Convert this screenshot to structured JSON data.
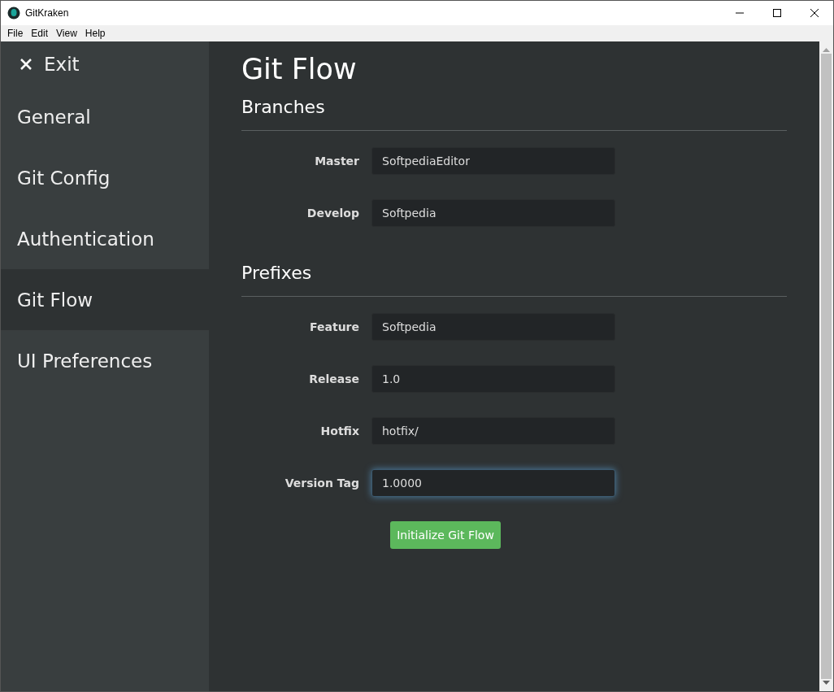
{
  "window": {
    "title": "GitKraken"
  },
  "menu": [
    "File",
    "Edit",
    "View",
    "Help"
  ],
  "sidebar": {
    "exit": "Exit",
    "items": [
      {
        "label": "General",
        "selected": false
      },
      {
        "label": "Git Config",
        "selected": false
      },
      {
        "label": "Authentication",
        "selected": false
      },
      {
        "label": "Git Flow",
        "selected": true
      },
      {
        "label": "UI Preferences",
        "selected": false
      }
    ]
  },
  "page": {
    "title": "Git Flow",
    "sections": [
      {
        "heading": "Branches",
        "fields": [
          {
            "label": "Master",
            "value": "SoftpediaEditor",
            "focused": false
          },
          {
            "label": "Develop",
            "value": "Softpedia",
            "focused": false
          }
        ]
      },
      {
        "heading": "Prefixes",
        "fields": [
          {
            "label": "Feature",
            "value": "Softpedia",
            "focused": false
          },
          {
            "label": "Release",
            "value": "1.0",
            "focused": false
          },
          {
            "label": "Hotfix",
            "value": "hotfix/",
            "focused": false
          },
          {
            "label": "Version Tag",
            "value": "1.0000",
            "focused": true
          }
        ]
      }
    ],
    "button": "Initialize Git Flow"
  }
}
